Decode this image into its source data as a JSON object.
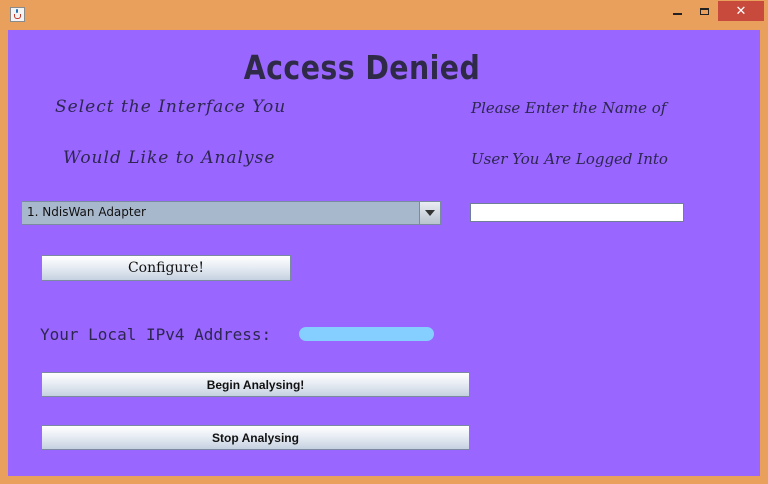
{
  "window": {
    "icon": "java-cup-icon",
    "controls": {
      "close": "✕"
    }
  },
  "form": {
    "heading": "Access Denied",
    "interface_label_line1": "Select the Interface You",
    "interface_label_line2": "Would Like to Analyse",
    "user_label_line1": "Please Enter the Name of",
    "user_label_line2": "User You Are Logged Into",
    "interface_select": {
      "selected": "1. NdisWan Adapter"
    },
    "user_name": {
      "value": ""
    },
    "configure_button": "Configure!",
    "ip_label": "Your Local IPv4 Address:",
    "begin_button": "Begin Analysing!",
    "stop_button": "Stop Analysing"
  },
  "colors": {
    "background": "#9966ff",
    "frame": "#e8a05c",
    "close_button": "#c74a3c",
    "redaction": "#84cfff"
  }
}
